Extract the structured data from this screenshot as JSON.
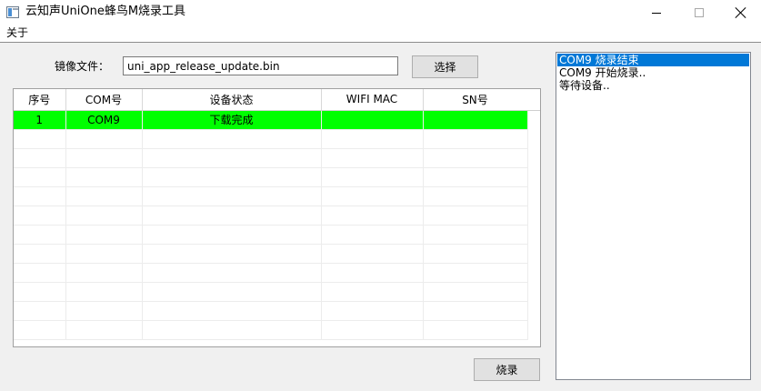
{
  "window": {
    "title": "云知声UniOne蜂鸟M烧录工具"
  },
  "menu": {
    "about": "关于"
  },
  "file": {
    "label": "镜像文件：",
    "value": "uni_app_release_update.bin"
  },
  "buttons": {
    "select": "选择",
    "burn": "烧录"
  },
  "table": {
    "headers": [
      "序号",
      "COM号",
      "设备状态",
      "WIFI MAC",
      "SN号"
    ],
    "rows": [
      {
        "index": "1",
        "com": "COM9",
        "status": "下载完成",
        "wifi_mac": "",
        "sn": "",
        "highlight": "#00ff00"
      }
    ],
    "empty_rows": 11
  },
  "log": {
    "items": [
      {
        "text": "COM9 烧录结束",
        "selected": true
      },
      {
        "text": "COM9 开始烧录..",
        "selected": false
      },
      {
        "text": "等待设备..",
        "selected": false
      }
    ]
  },
  "colors": {
    "active_row": "#00ff00",
    "selection": "#0078d7",
    "client_bg": "#f0f0f0"
  }
}
